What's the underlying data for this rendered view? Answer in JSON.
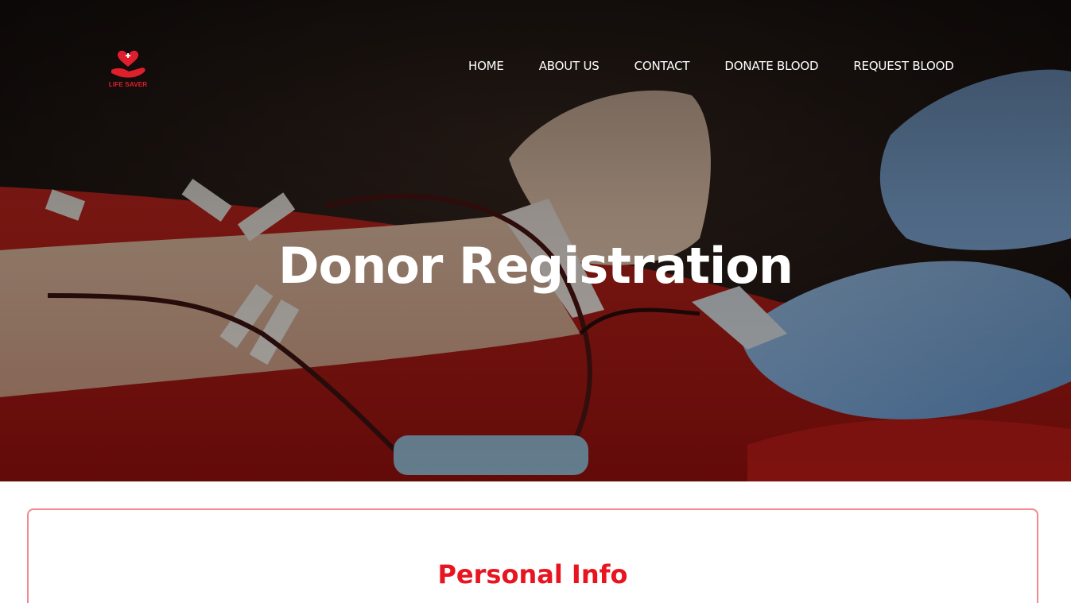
{
  "brand": {
    "name": "LIFE SAVER",
    "logo_icon": "heart-in-hand-icon",
    "color": "#e01f2d"
  },
  "nav": {
    "items": [
      {
        "label": "HOME"
      },
      {
        "label": "ABOUT US"
      },
      {
        "label": "CONTACT"
      },
      {
        "label": "DONATE BLOOD"
      },
      {
        "label": "REQUEST BLOOD"
      }
    ]
  },
  "hero": {
    "title": "Donor Registration",
    "image": "blood-donation-photo"
  },
  "form": {
    "section_title": "Personal Info",
    "accent": "#e8141f",
    "border_color": "#f08a8f"
  }
}
